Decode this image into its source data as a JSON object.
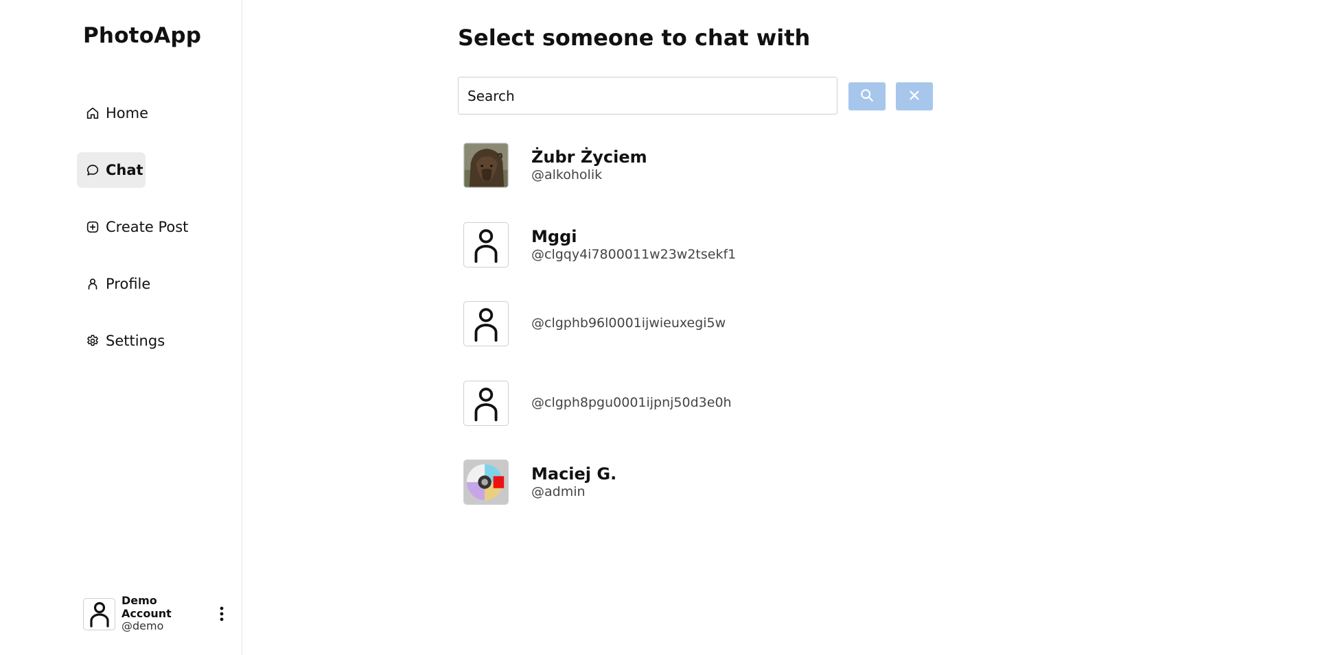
{
  "app": {
    "brand": "PhotoApp"
  },
  "sidebar": {
    "items": [
      {
        "label": "Home",
        "icon": "home-icon",
        "active": false
      },
      {
        "label": "Chat",
        "icon": "chat-bubble-icon",
        "active": true
      },
      {
        "label": "Create Post",
        "icon": "plus-square-icon",
        "active": false
      },
      {
        "label": "Profile",
        "icon": "person-icon",
        "active": false
      },
      {
        "label": "Settings",
        "icon": "gear-icon",
        "active": false
      }
    ],
    "account": {
      "name": "Demo Account",
      "handle": "@demo",
      "menu_icon": "vertical-ellipsis-icon"
    }
  },
  "main": {
    "title": "Select someone to chat with",
    "search": {
      "placeholder": "Search",
      "value": ""
    },
    "search_button_icon": "search-icon",
    "clear_button_icon": "close-icon",
    "accent_color": "#a6c6ec",
    "users": [
      {
        "name": "Żubr Życiem",
        "handle": "@alkoholik",
        "avatar": "bison-photo"
      },
      {
        "name": "Mggi",
        "handle": "@clgqy4i7800011w23w2tsekf1",
        "avatar": "default-person-icon"
      },
      {
        "name": "",
        "handle": "@clgphb96l0001ijwieuxegi5w",
        "avatar": "default-person-icon"
      },
      {
        "name": "",
        "handle": "@clgph8pgu0001ijpnj50d3e0h",
        "avatar": "default-person-icon"
      },
      {
        "name": "Maciej G.",
        "handle": "@admin",
        "avatar": "cd-album-art"
      }
    ]
  }
}
